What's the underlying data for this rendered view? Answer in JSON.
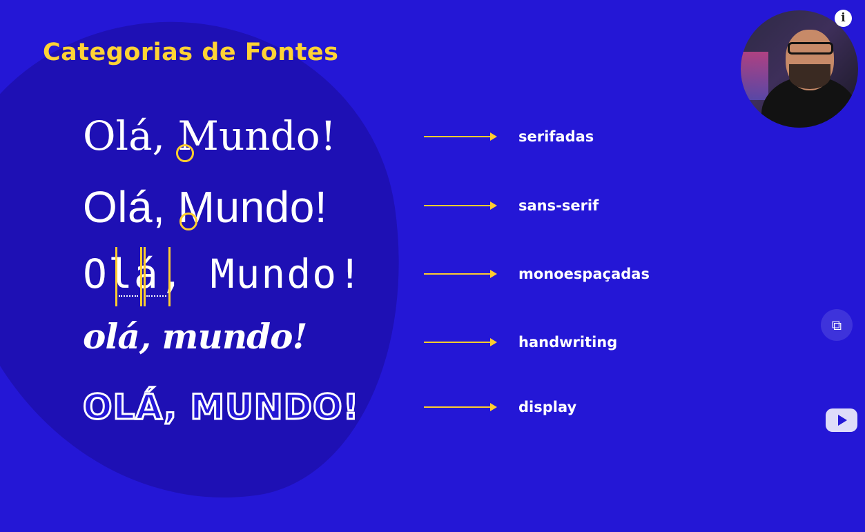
{
  "slide": {
    "title": "Categorias de Fontes",
    "accent_color": "#ffd335",
    "background_color": "#2417d6"
  },
  "rows": [
    {
      "sample": "Olá, Mundo!",
      "label": "serifadas"
    },
    {
      "sample": "Olá, Mundo!",
      "label": "sans-serif"
    },
    {
      "sample": "Olá, Mundo!",
      "label": "monoespaçadas"
    },
    {
      "sample": "olá, mundo!",
      "label": "handwriting"
    },
    {
      "sample": "OLÁ, MUNDO!",
      "label": "display"
    }
  ],
  "overlay": {
    "info_icon_text": "i",
    "pip_icon": "picture-in-picture-icon",
    "player_icon": "play-icon"
  }
}
